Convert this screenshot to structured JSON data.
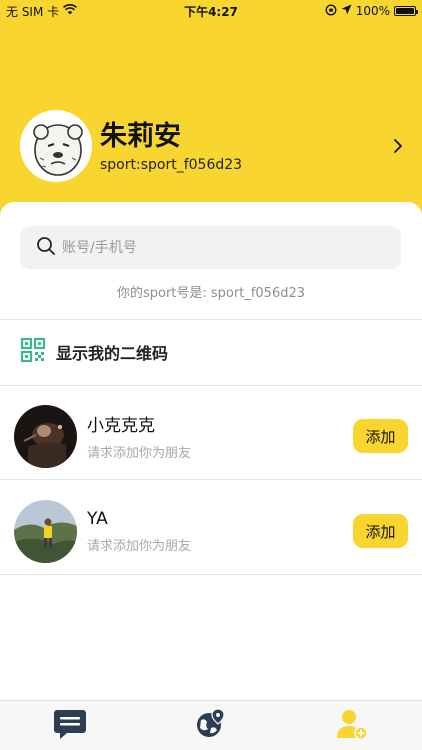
{
  "status_bar": {
    "carrier": "无 SIM 卡",
    "time": "下午4:27",
    "battery": "100%",
    "icons": [
      "wifi-icon",
      "orientation-lock-icon",
      "location-arrow-icon",
      "battery-icon"
    ]
  },
  "profile": {
    "name": "朱莉安",
    "sport_id": "sport:sport_f056d23",
    "avatar": "cartoon-avatar",
    "icons": [
      "chevron-right-icon"
    ]
  },
  "search": {
    "placeholder": "账号/手机号",
    "icon": "search-icon"
  },
  "sport_hint": "你的sport号是: sport_f056d23",
  "qr": {
    "label": "显示我的二维码",
    "icon": "qr-code-icon"
  },
  "friend_requests": [
    {
      "name": "小克克克",
      "subtitle": "请求添加你为朋友",
      "button": "添加"
    },
    {
      "name": "YA",
      "subtitle": "请求添加你为朋友",
      "button": "添加"
    }
  ],
  "tabbar": {
    "tabs": [
      {
        "icon": "chat-bubble-icon"
      },
      {
        "icon": "globe-pin-icon"
      },
      {
        "icon": "user-add-icon"
      }
    ]
  },
  "colors": {
    "accent": "#F9D52F",
    "tab_inactive": "#2E3E52",
    "qr_green": "#3DB88B"
  }
}
